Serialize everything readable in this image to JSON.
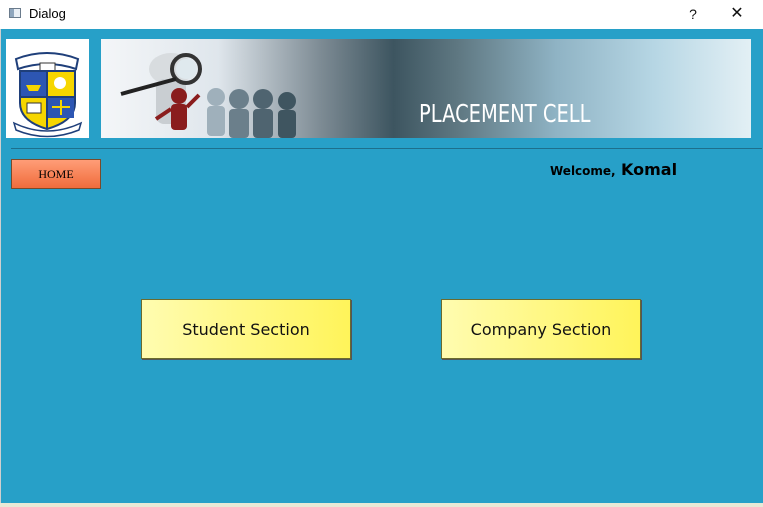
{
  "window": {
    "title": "Dialog",
    "help_label": "?",
    "close_label": "✕"
  },
  "banner": {
    "title": "PLACEMENT CELL",
    "logo_icon": "college-crest-icon",
    "banner_illustration": "magnifier-people-illustration"
  },
  "nav": {
    "home_label": "HOME"
  },
  "user": {
    "welcome_label": "Welcome,",
    "name": "Komal"
  },
  "actions": {
    "student_label": "Student Section",
    "company_label": "Company Section"
  },
  "colors": {
    "background": "#27a0c8",
    "home_button": "#f06c3c",
    "section_button": "#fff45a"
  }
}
